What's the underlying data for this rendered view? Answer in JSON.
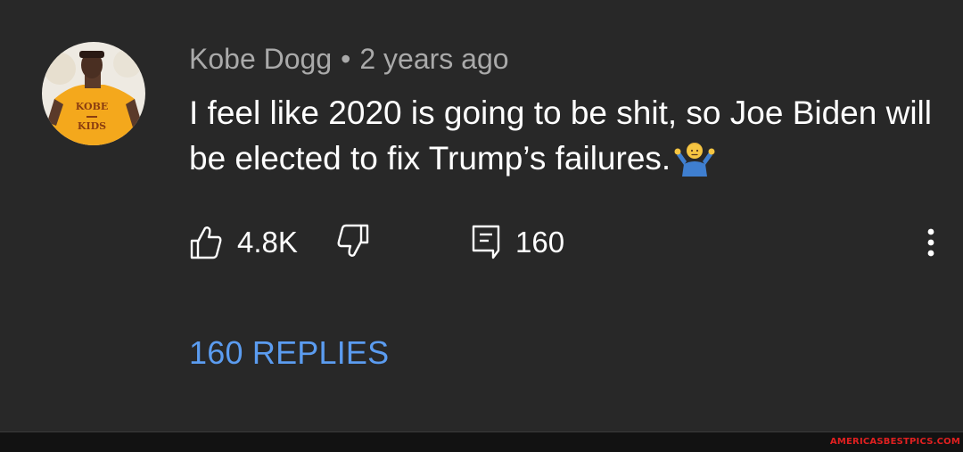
{
  "comment": {
    "author": "Kobe Dogg",
    "separator": "•",
    "time_ago": "2 years ago",
    "text": "I feel like 2020 is going to be shit, so Joe Biden will be elected to fix Trump’s failures.",
    "emoji": "person-shrugging-emoji",
    "avatar": "avatar"
  },
  "actions": {
    "like_count": "4.8K",
    "reply_count": "160",
    "icons": [
      "thumbs-up-icon",
      "thumbs-down-icon",
      "reply-comment-icon",
      "more-vertical-icon"
    ]
  },
  "replies": {
    "label": "160 REPLIES"
  },
  "footer": {
    "watermark": "AMERICASBESTPICS.COM"
  },
  "colors": {
    "background": "#282828",
    "meta_text": "#aaaaaa",
    "link_blue": "#5b9cf0",
    "watermark_red": "#e02020"
  }
}
